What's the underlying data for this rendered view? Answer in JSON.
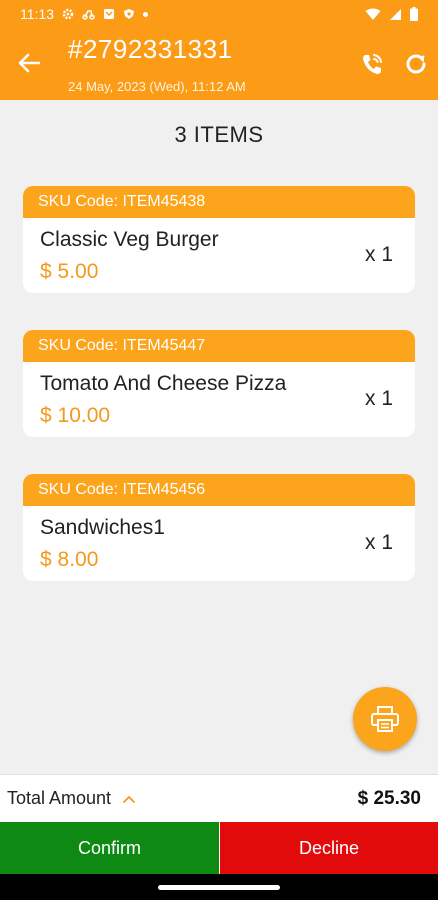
{
  "status_bar": {
    "time": "11:13"
  },
  "header": {
    "order_id": "#2792331331",
    "date": "24 May, 2023 (Wed), 11:12 AM"
  },
  "items_title": "3 ITEMS",
  "items": [
    {
      "sku": "SKU Code: ITEM45438",
      "name": "Classic Veg Burger",
      "price": "$ 5.00",
      "qty": "x 1"
    },
    {
      "sku": "SKU Code: ITEM45447",
      "name": "Tomato And Cheese Pizza",
      "price": "$ 10.00",
      "qty": "x 1"
    },
    {
      "sku": "SKU Code: ITEM45456",
      "name": "Sandwiches1",
      "price": "$ 8.00",
      "qty": "x 1"
    }
  ],
  "total": {
    "label": "Total Amount",
    "value": "$ 25.30"
  },
  "actions": {
    "confirm": "Confirm",
    "decline": "Decline"
  },
  "icons": {
    "back": "arrow-left-icon",
    "call": "phone-call-icon",
    "refresh": "refresh-icon",
    "print": "printer-icon",
    "expand": "chevron-up-icon"
  },
  "colors": {
    "brand_orange": "#fb9b16",
    "price_orange": "#f39a1c",
    "confirm_green": "#0e8a14",
    "decline_red": "#e20b0b"
  }
}
